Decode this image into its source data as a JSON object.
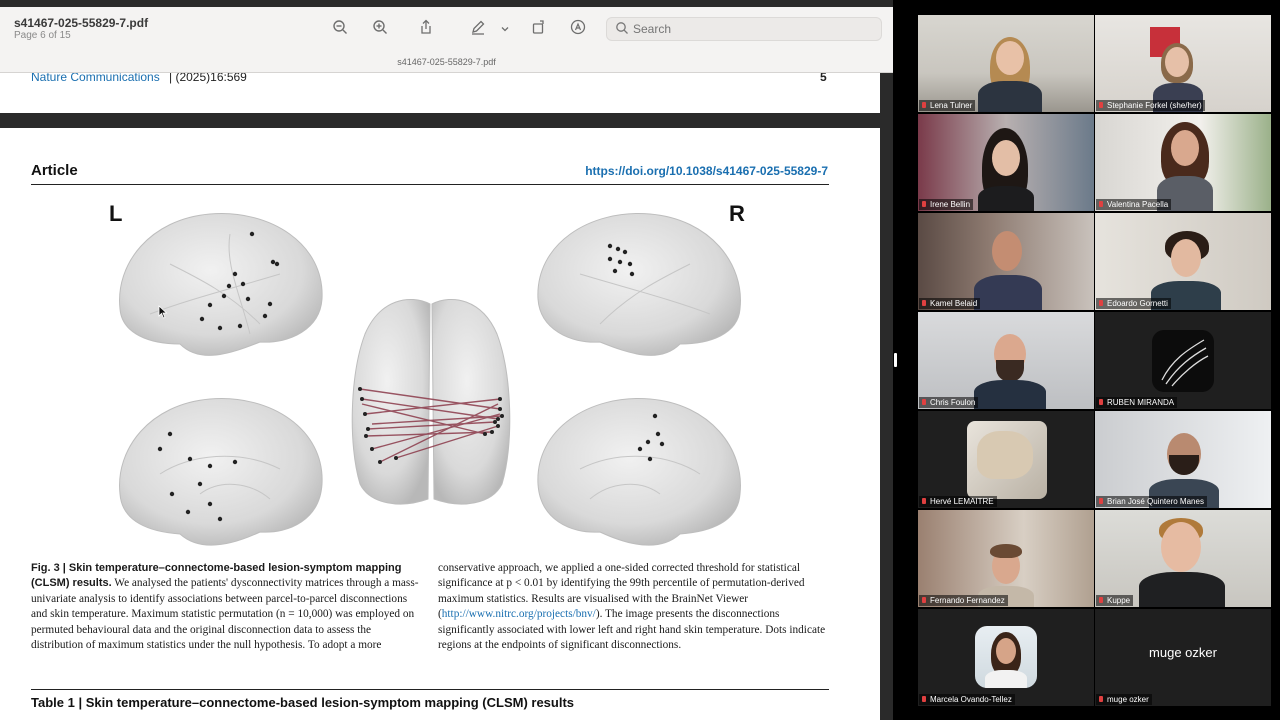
{
  "pdf": {
    "file_name": "s41467-025-55829-7.pdf",
    "page_info": "Page 6 of 15",
    "window_title": "s41467-025-55829-7.pdf",
    "search_placeholder": "Search",
    "toolbar_icons": [
      "zoom-out-icon",
      "zoom-in-icon",
      "share-icon",
      "markup-pen-icon",
      "chevron-down-icon",
      "rotate-icon",
      "annotate-icon"
    ],
    "prev_page": {
      "journal": "Nature Communications",
      "citation": "| (2025)16:569",
      "page_number": "5"
    },
    "page": {
      "section_label": "Article",
      "doi": "https://doi.org/10.1038/s41467-025-55829-7",
      "left_label": "L",
      "right_label": "R",
      "caption_col1_bold": "Fig. 3 | Skin temperature–connectome-based lesion-symptom mapping (CLSM) results.",
      "caption_col1_text": " We analysed the patients' dysconnectivity matrices through a mass-univariate analysis to identify associations between parcel-to-parcel disconnections and skin temperature. Maximum statistic permutation (n = 10,000) was employed on permuted behavioural data and the original disconnection data to assess the distribution of maximum statistics under the null hypothesis. To adopt a more",
      "caption_col2_a": "conservative approach, we applied a one-sided corrected threshold for statistical significance at p < 0.01 by identifying the 99th percentile of permutation-derived maximum statistics. Results are visualised with the BrainNet Viewer (",
      "caption_col2_link": "http://www.nitrc.org/projects/bnv/",
      "caption_col2_b": "). The image presents the disconnections significantly associated with lower left and right hand skin temperature. Dots indicate regions at the endpoints of significant disconnections.",
      "table_title": "Table 1 | Skin temperature–connectome-based lesion-symptom mapping (CLSM) results"
    }
  },
  "participants": [
    {
      "name": "Lena Tulner",
      "active": false
    },
    {
      "name": "Stephanie Forkel (she/her)",
      "active": false
    },
    {
      "name": "Irene Bellin",
      "active": false
    },
    {
      "name": "Valentina Pacella",
      "active": true
    },
    {
      "name": "Kamel Belaid",
      "active": false
    },
    {
      "name": "Edoardo Gornetti",
      "active": false
    },
    {
      "name": "Chris Foulon",
      "active": false
    },
    {
      "name": "RUBEN MIRANDA",
      "active": false
    },
    {
      "name": "Hervé LEMAITRE",
      "active": false
    },
    {
      "name": "Brian José Quintero Manes",
      "active": false
    },
    {
      "name": "Fernando Fernandez",
      "active": false
    },
    {
      "name": "Kuppe",
      "active": false
    },
    {
      "name": "Marcela Ovando-Tellez",
      "active": false
    },
    {
      "name": "muge ozker",
      "active": false,
      "video_off_label": "muge ozker"
    }
  ],
  "colors": {
    "link": "#1a6fb0",
    "active_speaker": "#5cc85c",
    "mic_muted": "#e04040"
  }
}
